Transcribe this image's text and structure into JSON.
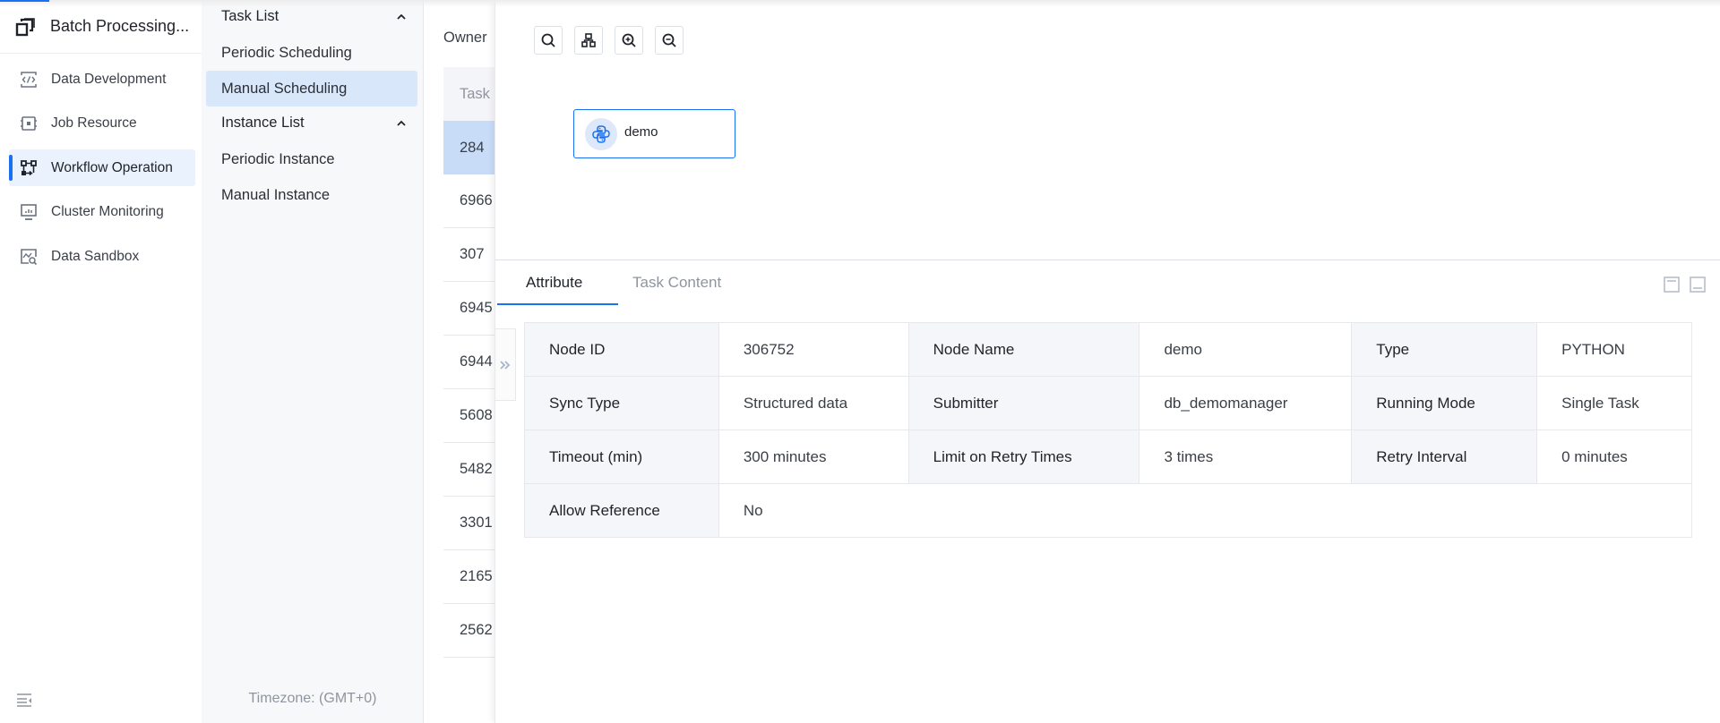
{
  "app": {
    "title": "Batch Processing...",
    "accent_color": "#1a6ff2"
  },
  "sidebar": {
    "items": [
      {
        "label": "Data Development",
        "icon": "code-icon",
        "active": false
      },
      {
        "label": "Job Resource",
        "icon": "chip-icon",
        "active": false
      },
      {
        "label": "Workflow Operation",
        "icon": "workflow-icon",
        "active": true
      },
      {
        "label": "Cluster Monitoring",
        "icon": "monitor-icon",
        "active": false
      },
      {
        "label": "Data Sandbox",
        "icon": "sandbox-icon",
        "active": false
      }
    ],
    "collapse_icon": "collapse-menu-icon"
  },
  "submenu": {
    "groups": [
      {
        "label": "Task List",
        "expanded": true,
        "items": [
          "Periodic Scheduling",
          "Manual Scheduling"
        ]
      },
      {
        "label": "Instance List",
        "expanded": true,
        "items": [
          "Periodic Instance",
          "Manual Instance"
        ]
      }
    ],
    "active_item": "Manual Scheduling",
    "timezone": "Timezone: (GMT+0)"
  },
  "tasklist": {
    "filter_label": "Owner",
    "column_header": "Task",
    "rows": [
      "284",
      "6966",
      "307",
      "6945",
      "6944",
      "5608",
      "5482",
      "3301",
      "2165",
      "2562"
    ],
    "selected_row": "284"
  },
  "canvas": {
    "toolbar": [
      "search-icon",
      "layout-icon",
      "zoom-in-icon",
      "zoom-out-icon"
    ],
    "node": {
      "label": "demo",
      "icon": "python-icon"
    }
  },
  "detail": {
    "tabs": [
      {
        "label": "Attribute",
        "active": true
      },
      {
        "label": "Task Content",
        "active": false
      }
    ],
    "attributes": [
      [
        {
          "k": "Node ID",
          "v": "306752"
        },
        {
          "k": "Node Name",
          "v": "demo"
        },
        {
          "k": "Type",
          "v": "PYTHON"
        }
      ],
      [
        {
          "k": "Sync Type",
          "v": "Structured data"
        },
        {
          "k": "Submitter",
          "v": "db_demomanager"
        },
        {
          "k": "Running Mode",
          "v": "Single Task"
        }
      ],
      [
        {
          "k": "Timeout (min)",
          "v": "300 minutes"
        },
        {
          "k": "Limit on Retry Times",
          "v": "3 times"
        },
        {
          "k": "Retry Interval",
          "v": "0 minutes"
        }
      ],
      [
        {
          "k": "Allow Reference",
          "v": "No"
        }
      ]
    ]
  }
}
